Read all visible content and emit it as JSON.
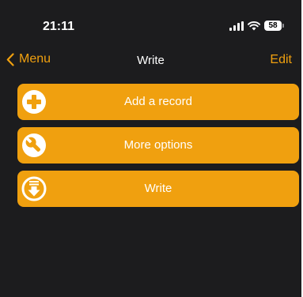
{
  "status_bar": {
    "time": "21:11",
    "battery": "58",
    "icons": [
      "signal-icon",
      "wifi-icon",
      "battery-icon"
    ]
  },
  "nav": {
    "back_label": "Menu",
    "title": "Write",
    "edit_label": "Edit"
  },
  "actions": [
    {
      "label": "Add a record",
      "icon": "plus-circle-icon"
    },
    {
      "label": "More options",
      "icon": "wrench-icon"
    },
    {
      "label": "Write",
      "icon": "download-icon"
    }
  ],
  "colors": {
    "accent": "#f0a00f",
    "background": "#1c1c1e",
    "text": "#ffffff"
  }
}
